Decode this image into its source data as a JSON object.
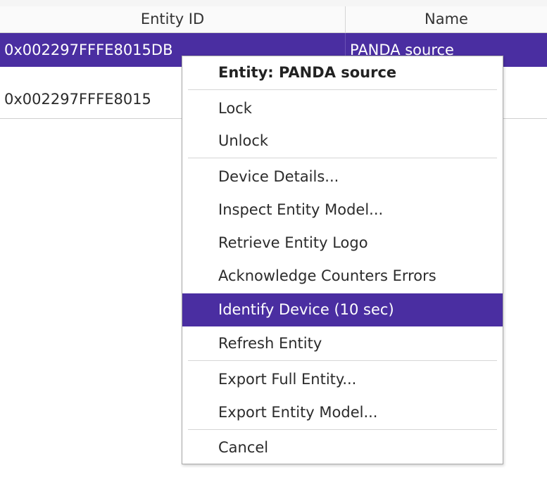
{
  "table": {
    "columns": [
      "Entity ID",
      "Name"
    ],
    "rows": [
      {
        "entity_id": "0x002297FFFE8015DB",
        "name": "PANDA source",
        "selected": true
      },
      {
        "entity_id": "0x002297FFFE8015",
        "name": "",
        "selected": false
      }
    ]
  },
  "context_menu": {
    "title": "Entity: PANDA source",
    "items": [
      {
        "label": "Lock"
      },
      {
        "label": "Unlock"
      },
      {
        "label": "Device Details..."
      },
      {
        "label": "Inspect Entity Model..."
      },
      {
        "label": "Retrieve Entity Logo"
      },
      {
        "label": "Acknowledge Counters Errors"
      },
      {
        "label": "Identify Device (10 sec)",
        "highlighted": true
      },
      {
        "label": "Refresh Entity"
      },
      {
        "label": "Export Full Entity..."
      },
      {
        "label": "Export Entity Model..."
      },
      {
        "label": "Cancel"
      }
    ]
  },
  "colors": {
    "selection": "#4a2ea1",
    "menu_border": "#a8a8a8",
    "separator": "#d6d6d6"
  }
}
